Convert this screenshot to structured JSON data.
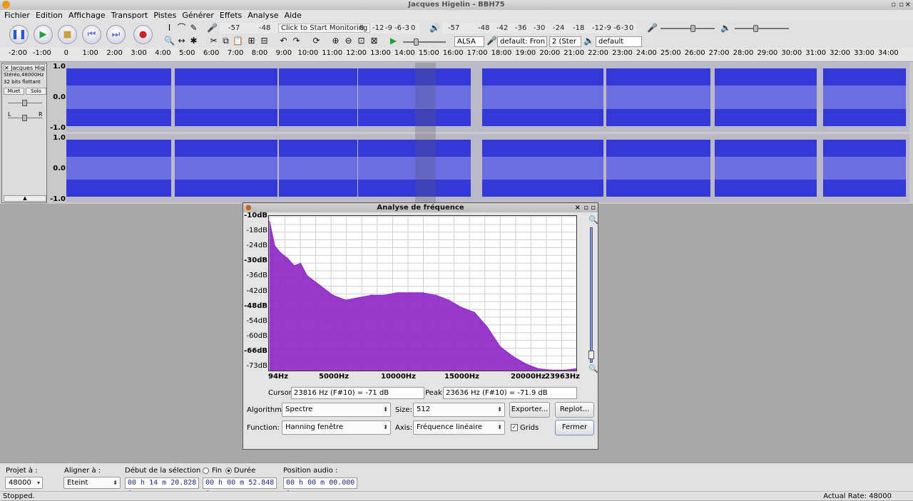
{
  "window": {
    "title": "Jacques Higelin - BBH75"
  },
  "menu": [
    "Fichier",
    "Edition",
    "Affichage",
    "Transport",
    "Pistes",
    "Générer",
    "Effets",
    "Analyse",
    "Aide"
  ],
  "toolbar": {
    "monitor_text": "Click to Start Monitoring",
    "rec_meter_ticks": [
      "-57",
      "-48",
      "8",
      "-12",
      "-9",
      "-6",
      "-3",
      "0"
    ],
    "play_meter_ticks": [
      "-57",
      "-48",
      "-42",
      "-36",
      "-30",
      "-24",
      "-18",
      "-12",
      "-9",
      "-6",
      "-3",
      "0"
    ],
    "host": "ALSA",
    "rec_device": "default: Fron",
    "channels": "2 (Ster",
    "play_device": "default"
  },
  "ruler": [
    "-2:00",
    "-1:00",
    "0",
    "1:00",
    "2:00",
    "3:00",
    "4:00",
    "5:00",
    "6:00",
    "7:00",
    "8:00",
    "9:00",
    "10:00",
    "11:00",
    "12:00",
    "13:00",
    "14:00",
    "15:00",
    "16:00",
    "17:00",
    "18:00",
    "19:00",
    "20:00",
    "21:00",
    "22:00",
    "23:00",
    "24:00",
    "25:00",
    "26:00",
    "27:00",
    "28:00",
    "29:00",
    "30:00",
    "31:00",
    "32:00",
    "33:00",
    "34:00"
  ],
  "track": {
    "name": "Jacques Hig",
    "rate": "Stéréo,48000Hz",
    "format": "32 bits flottant",
    "mute": "Muet",
    "solo": "Solo",
    "pan_l": "L",
    "pan_r": "R",
    "scale_top": [
      "1.0",
      "0.0",
      "-1.0"
    ],
    "scale_bottom": [
      "1.0",
      "0.0",
      "-1.0"
    ]
  },
  "dialog": {
    "title": "Analyse de fréquence",
    "cursor_label": "Cursor:",
    "cursor_value": "23816 Hz (F#10) = -71 dB",
    "peak_label": "Peak:",
    "peak_value": "23636 Hz (F#10) = -71.9 dB",
    "algorithm_label": "Algorithm:",
    "algorithm_value": "Spectre",
    "size_label": "Size:",
    "size_value": "512",
    "export_label": "Exporter...",
    "replot_label": "Replot...",
    "function_label": "Function:",
    "function_value": "Hanning fenêtre",
    "axis_label": "Axis:",
    "axis_value": "Fréquence linéaire",
    "grids_label": "Grids",
    "close_label": "Fermer"
  },
  "chart_data": {
    "type": "area",
    "y_ticks": [
      "-10dB",
      "-18dB",
      "-24dB",
      "-30dB",
      "-36dB",
      "-42dB",
      "-48dB",
      "-54dB",
      "-60dB",
      "-66dB",
      "-73dB"
    ],
    "x_ticks": [
      "94Hz",
      "5000Hz",
      "10000Hz",
      "15000Hz",
      "20000Hz",
      "23963Hz"
    ],
    "xlim": [
      94,
      23963
    ],
    "ylim": [
      -73,
      -10
    ],
    "x": [
      94,
      500,
      1000,
      1500,
      2000,
      2500,
      3000,
      4000,
      5000,
      6000,
      7000,
      8000,
      9000,
      10000,
      11000,
      12000,
      13000,
      14000,
      15000,
      16000,
      17000,
      18000,
      19000,
      20000,
      21000,
      22000,
      23000,
      23963
    ],
    "values": [
      -12,
      -22,
      -25,
      -27,
      -30,
      -29,
      -34,
      -38,
      -42,
      -44,
      -43,
      -42,
      -42,
      -41,
      -41,
      -41,
      -42,
      -44,
      -47,
      -49,
      -55,
      -63,
      -67,
      -70,
      -72,
      -72.5,
      -72.5,
      -71.9
    ],
    "grid": true,
    "color": "#9028c8"
  },
  "bottom": {
    "project_label": "Projet à :",
    "project_value": "48000",
    "snap_label": "Aligner à :",
    "snap_value": "Eteint",
    "sel_start_label": "Début de la sélection",
    "end_label": "Fin",
    "length_label": "Durée",
    "audio_pos_label": "Position audio :",
    "sel_start": "00 h 14 m 20.828 s",
    "sel_length": "00 h 00 m 52.848 s",
    "audio_pos": "00 h 00 m 00.000 s"
  },
  "status": {
    "left": "Stopped.",
    "right": "Actual Rate: 48000"
  }
}
